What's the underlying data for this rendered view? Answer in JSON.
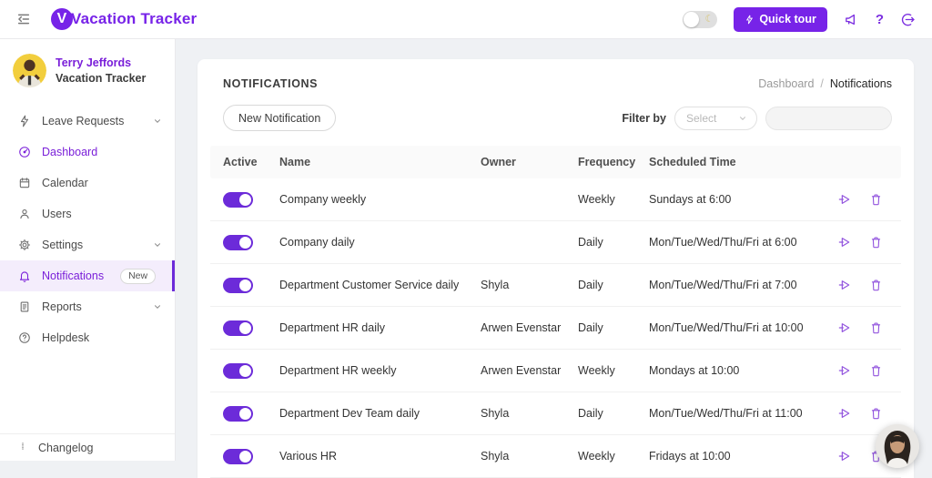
{
  "header": {
    "app_name": "Vacation Tracker",
    "logo_initial": "V",
    "quick_tour_label": "Quick tour"
  },
  "sidebar": {
    "user": {
      "name": "Terry Jeffords",
      "company": "Vacation Tracker"
    },
    "items": [
      {
        "label": "Leave Requests"
      },
      {
        "label": "Dashboard"
      },
      {
        "label": "Calendar"
      },
      {
        "label": "Users"
      },
      {
        "label": "Settings"
      },
      {
        "label": "Notifications",
        "badge": "New"
      },
      {
        "label": "Reports"
      },
      {
        "label": "Helpdesk"
      }
    ],
    "changelog_label": "Changelog"
  },
  "main": {
    "title": "NOTIFICATIONS",
    "breadcrumb": {
      "parent": "Dashboard",
      "separator": "/",
      "current": "Notifications"
    },
    "new_notification_label": "New Notification",
    "filter": {
      "label": "Filter by",
      "select_placeholder": "Select"
    },
    "table": {
      "columns": {
        "active": "Active",
        "name": "Name",
        "owner": "Owner",
        "frequency": "Frequency",
        "scheduled_time": "Scheduled Time"
      },
      "rows": [
        {
          "active": true,
          "name": "Company weekly",
          "owner": "",
          "frequency": "Weekly",
          "scheduled_time": "Sundays at 6:00"
        },
        {
          "active": true,
          "name": "Company daily",
          "owner": "",
          "frequency": "Daily",
          "scheduled_time": "Mon/Tue/Wed/Thu/Fri at 6:00"
        },
        {
          "active": true,
          "name": "Department Customer Service daily",
          "owner": "Shyla",
          "frequency": "Daily",
          "scheduled_time": "Mon/Tue/Wed/Thu/Fri at 7:00"
        },
        {
          "active": true,
          "name": "Department HR daily",
          "owner": "Arwen Evenstar",
          "frequency": "Daily",
          "scheduled_time": "Mon/Tue/Wed/Thu/Fri at 10:00"
        },
        {
          "active": true,
          "name": "Department HR weekly",
          "owner": "Arwen Evenstar",
          "frequency": "Weekly",
          "scheduled_time": "Mondays at 10:00"
        },
        {
          "active": true,
          "name": "Department Dev Team daily",
          "owner": "Shyla",
          "frequency": "Daily",
          "scheduled_time": "Mon/Tue/Wed/Thu/Fri at 11:00"
        },
        {
          "active": true,
          "name": "Various HR",
          "owner": "Shyla",
          "frequency": "Weekly",
          "scheduled_time": "Fridays at 10:00"
        }
      ]
    }
  },
  "colors": {
    "brand_purple": "#7723e8",
    "toggle_purple": "#6c2bd9",
    "action_icon_purple": "#9254de",
    "active_nav_bg": "#f4edfc"
  }
}
